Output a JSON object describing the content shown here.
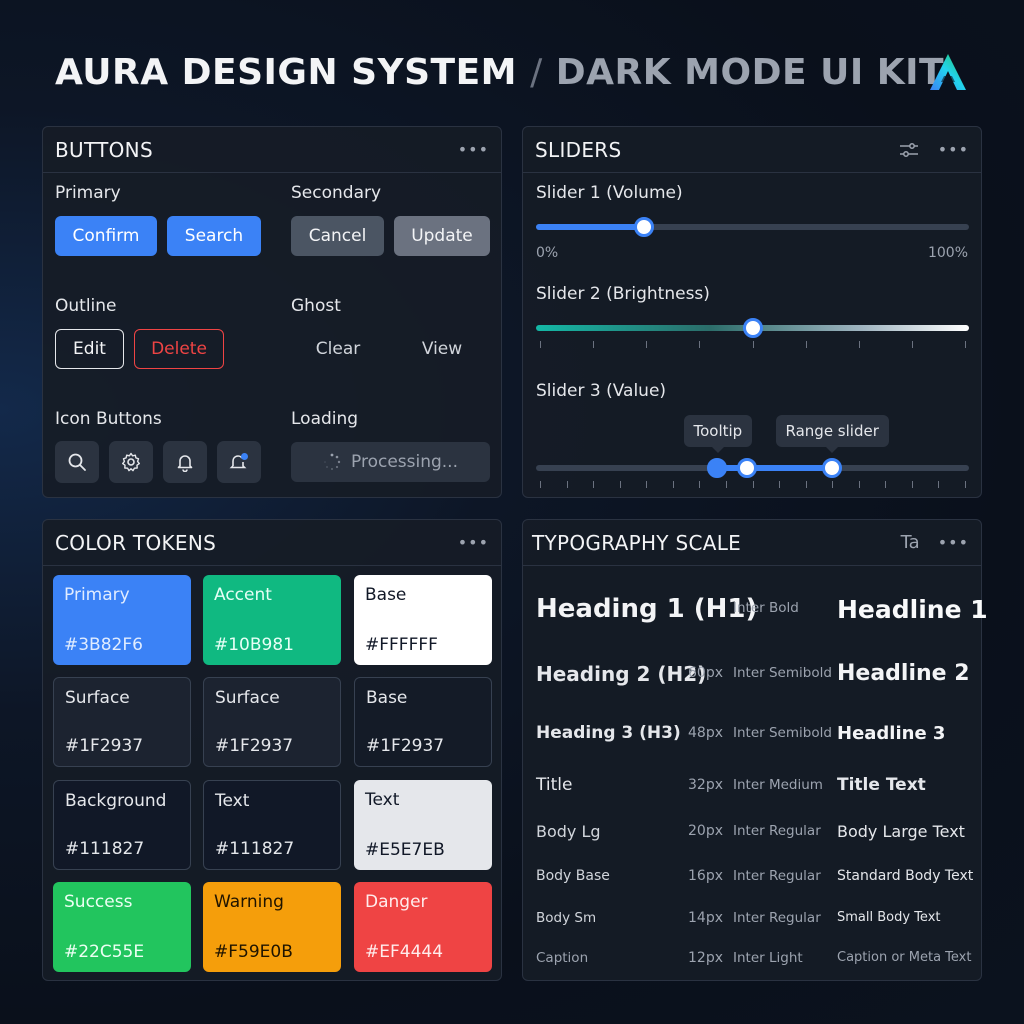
{
  "header": {
    "title_main": "AURA DESIGN SYSTEM",
    "separator": "/",
    "title_sub": "DARK MODE UI KIT"
  },
  "colors": {
    "primary": "#3B82F6",
    "accent": "#10B981",
    "danger": "#EF4444",
    "warning": "#F59E0B",
    "success": "#22C55E"
  },
  "buttons_panel": {
    "title": "BUTTONS",
    "primary_label": "Primary",
    "primary_buttons": [
      "Confirm",
      "Search"
    ],
    "secondary_label": "Secondary",
    "secondary_buttons": [
      "Cancel",
      "Update"
    ],
    "outline_label": "Outline",
    "outline_buttons": [
      "Edit",
      "Delete"
    ],
    "ghost_label": "Ghost",
    "ghost_buttons": [
      "Clear",
      "View"
    ],
    "icon_label": "Icon Buttons",
    "icon_buttons": [
      "search-icon",
      "gear-icon",
      "bell-icon",
      "notification-icon"
    ],
    "loading_label": "Loading",
    "loading_button": "Processing..."
  },
  "sliders_panel": {
    "title": "SLIDERS",
    "slider1": {
      "label": "Slider 1 (Volume)",
      "value": 25,
      "min_label": "0%",
      "max_label": "100%"
    },
    "slider2": {
      "label": "Slider 2 (Brightness)",
      "value": 50
    },
    "slider3": {
      "label": "Slider 3 (Value)",
      "tooltip": "Tooltip",
      "range_label": "Range slider",
      "value_start": 43,
      "value_mid": 43,
      "value_end": 68
    }
  },
  "colors_panel": {
    "title": "COLOR TOKENS",
    "swatches": [
      {
        "name": "Primary",
        "hex": "#3B82F6",
        "bg": "#3B82F6",
        "fg": "#e0ecff"
      },
      {
        "name": "Accent",
        "hex": "#10B981",
        "bg": "#10B981",
        "fg": "#e6fff6"
      },
      {
        "name": "Base",
        "hex": "#FFFFFF",
        "bg": "#FFFFFF",
        "fg": "#111827"
      },
      {
        "name": "Surface",
        "hex": "#1F2937",
        "bg": "#1c2330",
        "fg": "#e5e7eb"
      },
      {
        "name": "Surface",
        "hex": "#1F2937",
        "bg": "#1c2330",
        "fg": "#e5e7eb"
      },
      {
        "name": "Base",
        "hex": "#1F2937",
        "bg": "#141b27",
        "fg": "#e5e7eb"
      },
      {
        "name": "Background",
        "hex": "#111827",
        "bg": "#111827",
        "fg": "#e5e7eb"
      },
      {
        "name": "Text",
        "hex": "#111827",
        "bg": "#111827",
        "fg": "#e5e7eb"
      },
      {
        "name": "Text",
        "hex": "#E5E7EB",
        "bg": "#E5E7EB",
        "fg": "#111827"
      },
      {
        "name": "Success",
        "hex": "#22C55E",
        "bg": "#22C55E",
        "fg": "#ecfff3"
      },
      {
        "name": "Warning",
        "hex": "#F59E0B",
        "bg": "#F59E0B",
        "fg": "#1f1400"
      },
      {
        "name": "Danger",
        "hex": "#EF4444",
        "bg": "#EF4444",
        "fg": "#ffecec"
      }
    ]
  },
  "type_panel": {
    "title": "TYPOGRAPHY SCALE",
    "icon_text": "Ta",
    "rows": [
      {
        "name": "Heading 1 (H1)",
        "size": "",
        "font": "Inter Bold",
        "sample": "Headline 1"
      },
      {
        "name": "Heading 2 (H2)",
        "size": "60px",
        "font": "Inter Semibold",
        "sample": "Headline 2"
      },
      {
        "name": "Heading 3 (H3)",
        "size": "48px",
        "font": "Inter Semibold",
        "sample": "Headline 3"
      },
      {
        "name": "Title",
        "size": "32px",
        "font": "Inter Medium",
        "sample": "Title Text"
      },
      {
        "name": "Body Lg",
        "size": "20px",
        "font": "Inter Regular",
        "sample": "Body Large Text"
      },
      {
        "name": "Body Base",
        "size": "16px",
        "font": "Inter Regular",
        "sample": "Standard Body Text"
      },
      {
        "name": "Body Sm",
        "size": "14px",
        "font": "Inter Regular",
        "sample": "Small Body Text"
      },
      {
        "name": "Caption",
        "size": "12px",
        "font": "Inter Light",
        "sample": "Caption or Meta Text"
      }
    ]
  }
}
